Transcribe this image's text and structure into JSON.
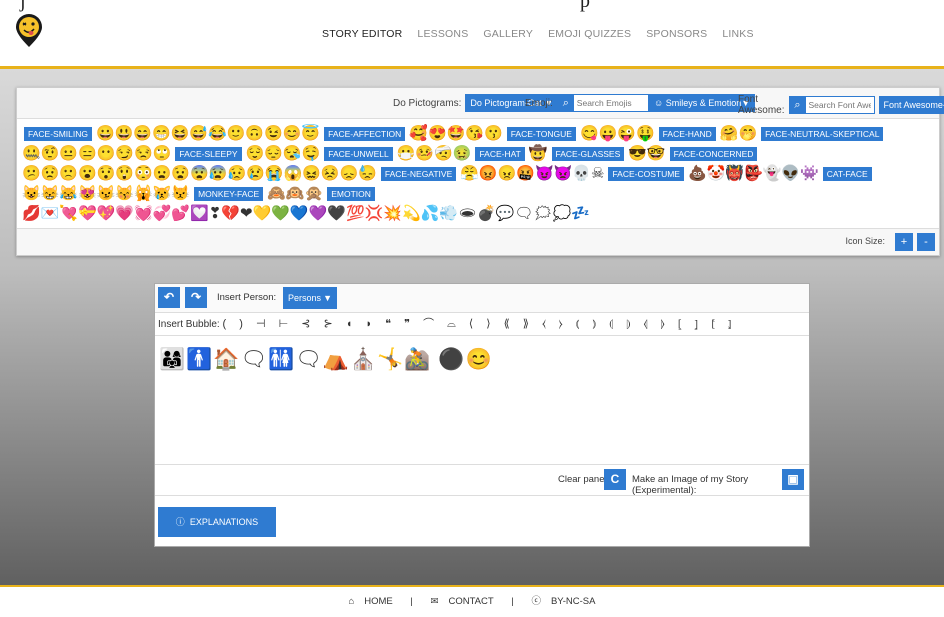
{
  "clip_text": "j",
  "clip_tail": "p",
  "nav": [
    "STORY EDITOR",
    "LESSONS",
    "GALLERY",
    "EMOJI QUIZZES",
    "SPONSORS",
    "LINKS"
  ],
  "toolbar": {
    "pictograms_label": "Do Pictograms:",
    "pictograms_select": "Do Pictogram-Cat",
    "emoji_label": "Emoji:",
    "emoji_placeholder": "Search Emojis",
    "emoji_category": "Smileys & Emotion",
    "fa_label": "Font Awesome:",
    "fa_placeholder": "Search Font Awesome",
    "fa_category": "Font Awesome-Cat"
  },
  "emoji_groups": [
    {
      "tag": "FACE-SMILING",
      "emojis": "😀😃😄😁😆😅😂🙂🙃😉😊😇"
    },
    {
      "tag": "FACE-AFFECTION",
      "emojis": "🥰😍🤩😘😗"
    },
    {
      "tag": "FACE-TONGUE",
      "emojis": "😋😛😜🤑"
    },
    {
      "tag": "FACE-HAND",
      "emojis": "🤗🤭"
    },
    {
      "tag": "FACE-NEUTRAL-SKEPTICAL",
      "emojis": "🤐🤨😐😑😶😏😒🙄"
    },
    {
      "tag": "FACE-SLEEPY",
      "emojis": "😌😔😪🤤"
    },
    {
      "tag": "FACE-UNWELL",
      "emojis": "😷🤒🤕🤢"
    },
    {
      "tag": "FACE-HAT",
      "emojis": "🤠"
    },
    {
      "tag": "FACE-GLASSES",
      "emojis": "😎🤓"
    },
    {
      "tag": "FACE-CONCERNED",
      "emojis": "😕😟🙁😮😯😲😳😦😧😨😰😥😢😭😱😖😣😞😓"
    },
    {
      "tag": "FACE-NEGATIVE",
      "emojis": "😤😡😠🤬😈👿💀☠"
    },
    {
      "tag": "FACE-COSTUME",
      "emojis": "💩🤡👹👺👻👽👾"
    },
    {
      "tag": "CAT-FACE",
      "emojis": "😺😸😹😻😼😽🙀😿😾"
    },
    {
      "tag": "MONKEY-FACE",
      "emojis": "🙈🙉🙊"
    },
    {
      "tag": "EMOTION",
      "emojis": "💋💌💘💝💖💗💓💞💕💟❣💔❤💛💚💙💜🖤💯💢💥💫💦💨🕳💣💬🗨🗯💭💤"
    }
  ],
  "icon_size_label": "Icon Size:",
  "icon_size_plus": "+",
  "icon_size_minus": "-",
  "editor": {
    "undo": "↶",
    "redo": "↷",
    "insert_person_label": "Insert Person:",
    "person_select": "Persons",
    "insert_bubble_label": "Insert Bubble:",
    "bubbles": "( ) ⊣ ⊢ ⊰ ⊱ ◖ ◗ ❝ ❞ ⌒ ⌓ ⟨ ⟩ ⟪ ⟫ ⧼ ⧽ ⦅ ⦆ ⦇ ⦈ ⦉ ⦊ ⦋ ⦌ ⦍ ⦎",
    "story_art": "👨‍👩‍👧🚹🏠🗨🚻🗨⛺⛪🤸🚵 ⚫😊",
    "clear_label": "Clear panel:",
    "clear_btn": "C",
    "image_label": "Make an Image of my Story (Experimental):",
    "image_btn": "▣",
    "explanations": "EXPLANATIONS"
  },
  "footer": {
    "home": "HOME",
    "contact": "CONTACT",
    "license": "BY-NC-SA",
    "sep": "|"
  }
}
